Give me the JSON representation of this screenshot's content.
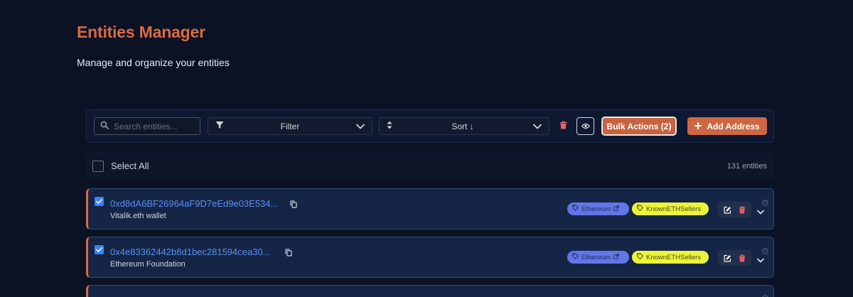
{
  "header": {
    "title": "Entities Manager",
    "subtitle": "Manage and organize your entities"
  },
  "toolbar": {
    "search_placeholder": "Search entities...",
    "filter_label": "Filter",
    "sort_label": "Sort ↓",
    "bulk_actions_label": "Bulk Actions (2)",
    "add_address_label": "Add Address"
  },
  "list": {
    "select_all_label": "Select All",
    "entity_count": "131 entities"
  },
  "rows": [
    {
      "address": "0xd8dA6BF26964aF9D7eEd9e03E534...",
      "label": "Vitalik.eth wallet",
      "tags": [
        "Ethereum",
        "KnownETHSellers"
      ],
      "selected": true
    },
    {
      "address": "0x4e83362442b8d1bec281594cea30...",
      "label": "Ethereum Foundation",
      "tags": [
        "Ethereum",
        "KnownETHSellers"
      ],
      "selected": true
    }
  ],
  "colors": {
    "background": "#0b1224",
    "accent": "#d96a43",
    "address_link": "#5b8ff0",
    "tag_ethereum": "#6177e8",
    "tag_known": "#ecf43a",
    "checkbox": "#3b82f6"
  },
  "icons": [
    "search-icon",
    "filter-icon",
    "sort-icon",
    "chevron-down-icon",
    "trash-icon",
    "eye-icon",
    "plus-icon",
    "copy-icon",
    "tag-icon",
    "external-link-icon",
    "edit-icon",
    "clock-icon"
  ]
}
